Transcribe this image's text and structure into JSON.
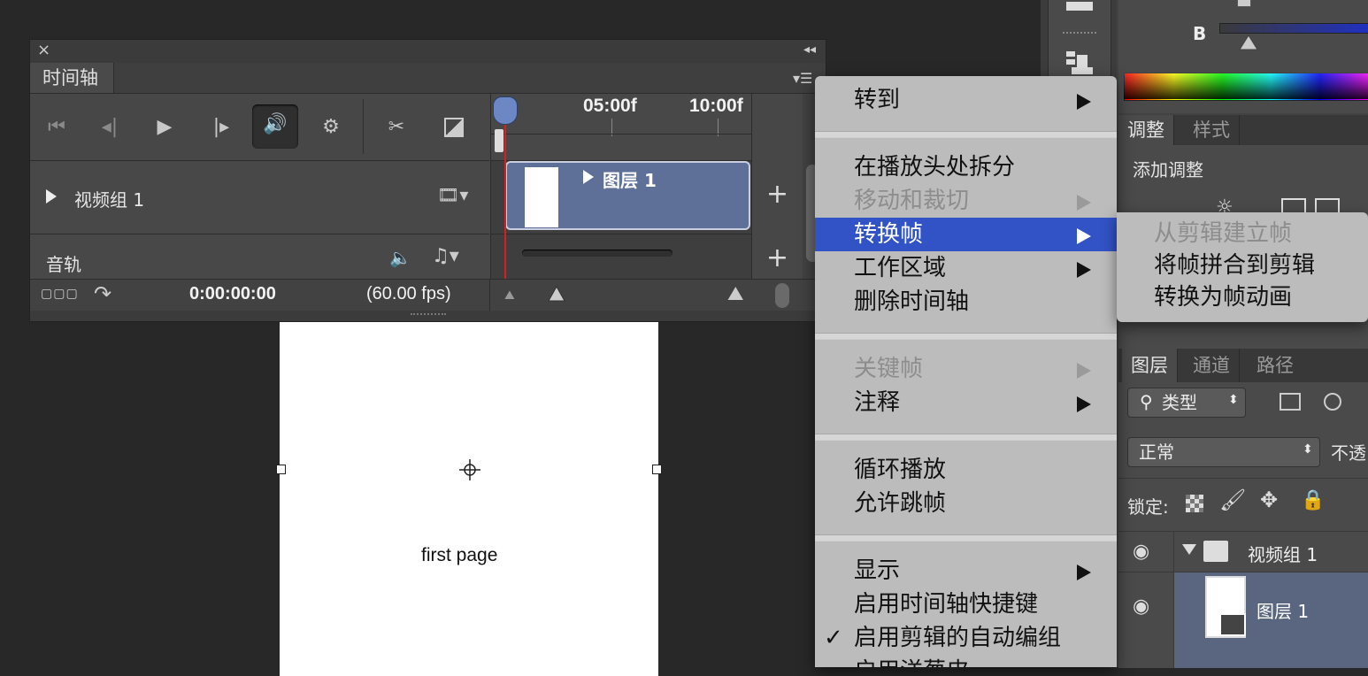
{
  "document": {
    "canvas_text": "first page"
  },
  "timeline": {
    "tab_title": "时间轴",
    "ruler_marks": [
      "05:00f",
      "10:00f"
    ],
    "tracks": {
      "video_group": "视频组 1",
      "audio": "音轨"
    },
    "clip_label": "图层 1",
    "timecode": "0:00:00:00",
    "fps": "(60.00 fps)"
  },
  "right_panels": {
    "color": {
      "channel_label": "B"
    },
    "adjustments": {
      "tabs": [
        "调整",
        "样式"
      ],
      "title": "添加调整"
    },
    "layers": {
      "tabs": [
        "图层",
        "通道",
        "路径"
      ],
      "filter_label": "类型",
      "blend_mode": "正常",
      "opacity_label": "不透",
      "lock_label": "锁定:",
      "rows": [
        {
          "name": "视频组 1"
        },
        {
          "name": "图层 1"
        }
      ]
    }
  },
  "context_menu": {
    "groups": [
      [
        {
          "label": "转到",
          "submenu": true,
          "disabled": false
        }
      ],
      [
        {
          "label": "在播放头处拆分",
          "submenu": false,
          "disabled": false
        },
        {
          "label": "移动和裁切",
          "submenu": true,
          "disabled": true
        },
        {
          "label": "转换帧",
          "submenu": true,
          "disabled": false,
          "highlighted": true
        },
        {
          "label": "工作区域",
          "submenu": true,
          "disabled": false
        },
        {
          "label": "删除时间轴",
          "submenu": false,
          "disabled": false
        }
      ],
      [
        {
          "label": "关键帧",
          "submenu": true,
          "disabled": true
        },
        {
          "label": "注释",
          "submenu": true,
          "disabled": false
        }
      ],
      [
        {
          "label": "循环播放",
          "submenu": false,
          "disabled": false
        },
        {
          "label": "允许跳帧",
          "submenu": false,
          "disabled": false
        }
      ],
      [
        {
          "label": "显示",
          "submenu": true,
          "disabled": false
        },
        {
          "label": "启用时间轴快捷键",
          "submenu": false,
          "disabled": false
        },
        {
          "label": "启用剪辑的自动编组",
          "submenu": false,
          "disabled": false,
          "checked": true,
          "check_mark": "✓"
        },
        {
          "label": "启用洋葱皮",
          "submenu": false,
          "disabled": false
        }
      ]
    ],
    "submenu": [
      {
        "label": "从剪辑建立帧",
        "disabled": true
      },
      {
        "label": "将帧拼合到剪辑",
        "disabled": false
      },
      {
        "label": "转换为帧动画",
        "disabled": false
      }
    ]
  },
  "colors": {
    "menu_highlight": "#3253c5",
    "clip_fill": "#5e6f98",
    "playhead_line": "#d32020",
    "selected_layer": "#5a6680"
  }
}
